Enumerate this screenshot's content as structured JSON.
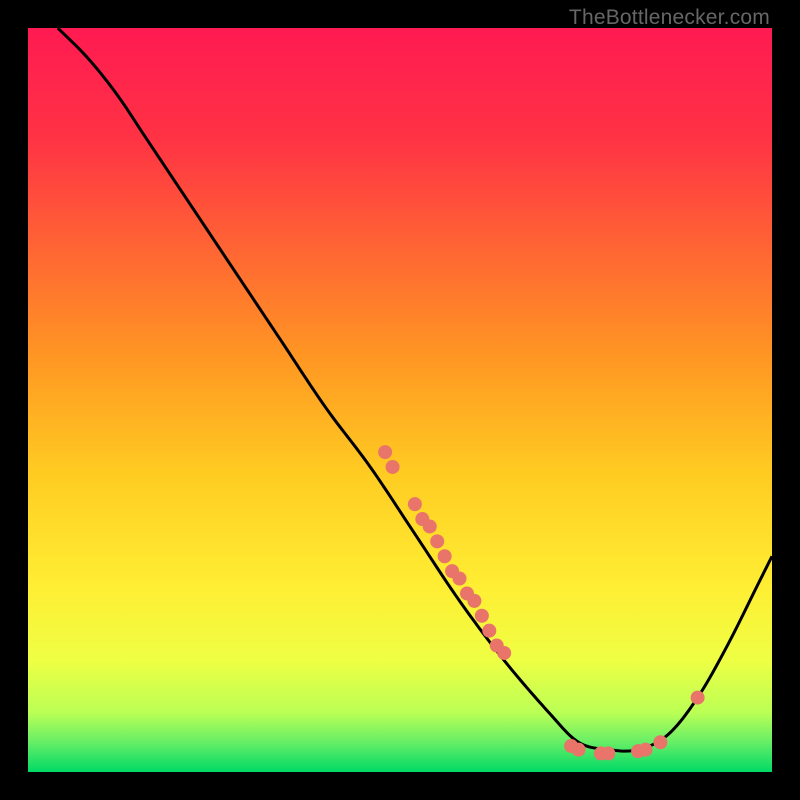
{
  "watermark": "TheBottlenecker.com",
  "chart_data": {
    "type": "line",
    "title": "",
    "xlabel": "",
    "ylabel": "",
    "xlim": [
      0,
      100
    ],
    "ylim": [
      0,
      100
    ],
    "grid": false,
    "curve": [
      {
        "x": 4,
        "y": 100
      },
      {
        "x": 8,
        "y": 96
      },
      {
        "x": 12,
        "y": 91
      },
      {
        "x": 16,
        "y": 85
      },
      {
        "x": 22,
        "y": 76
      },
      {
        "x": 28,
        "y": 67
      },
      {
        "x": 34,
        "y": 58
      },
      {
        "x": 40,
        "y": 49
      },
      {
        "x": 46,
        "y": 41
      },
      {
        "x": 52,
        "y": 32
      },
      {
        "x": 58,
        "y": 23
      },
      {
        "x": 64,
        "y": 15
      },
      {
        "x": 70,
        "y": 8
      },
      {
        "x": 74,
        "y": 4
      },
      {
        "x": 78,
        "y": 3
      },
      {
        "x": 82,
        "y": 3
      },
      {
        "x": 86,
        "y": 5
      },
      {
        "x": 90,
        "y": 10
      },
      {
        "x": 94,
        "y": 17
      },
      {
        "x": 98,
        "y": 25
      },
      {
        "x": 100,
        "y": 29
      }
    ],
    "scatter_points": [
      {
        "x": 48,
        "y": 43
      },
      {
        "x": 49,
        "y": 41
      },
      {
        "x": 52,
        "y": 36
      },
      {
        "x": 53,
        "y": 34
      },
      {
        "x": 54,
        "y": 33
      },
      {
        "x": 55,
        "y": 31
      },
      {
        "x": 56,
        "y": 29
      },
      {
        "x": 57,
        "y": 27
      },
      {
        "x": 58,
        "y": 26
      },
      {
        "x": 59,
        "y": 24
      },
      {
        "x": 60,
        "y": 23
      },
      {
        "x": 61,
        "y": 21
      },
      {
        "x": 62,
        "y": 19
      },
      {
        "x": 63,
        "y": 17
      },
      {
        "x": 64,
        "y": 16
      },
      {
        "x": 73,
        "y": 3.5
      },
      {
        "x": 74,
        "y": 3
      },
      {
        "x": 77,
        "y": 2.5
      },
      {
        "x": 78,
        "y": 2.5
      },
      {
        "x": 82,
        "y": 2.8
      },
      {
        "x": 83,
        "y": 3
      },
      {
        "x": 85,
        "y": 4
      },
      {
        "x": 90,
        "y": 10
      }
    ],
    "gradient_stops": [
      {
        "offset": 0.0,
        "color": "#ff1a52"
      },
      {
        "offset": 0.15,
        "color": "#ff3344"
      },
      {
        "offset": 0.3,
        "color": "#ff6633"
      },
      {
        "offset": 0.45,
        "color": "#ff9922"
      },
      {
        "offset": 0.6,
        "color": "#ffcc22"
      },
      {
        "offset": 0.75,
        "color": "#ffee33"
      },
      {
        "offset": 0.85,
        "color": "#eeff44"
      },
      {
        "offset": 0.92,
        "color": "#bbff55"
      },
      {
        "offset": 0.96,
        "color": "#66ee66"
      },
      {
        "offset": 1.0,
        "color": "#00d966"
      }
    ],
    "point_color": "#e8746a",
    "line_color": "#000000"
  }
}
